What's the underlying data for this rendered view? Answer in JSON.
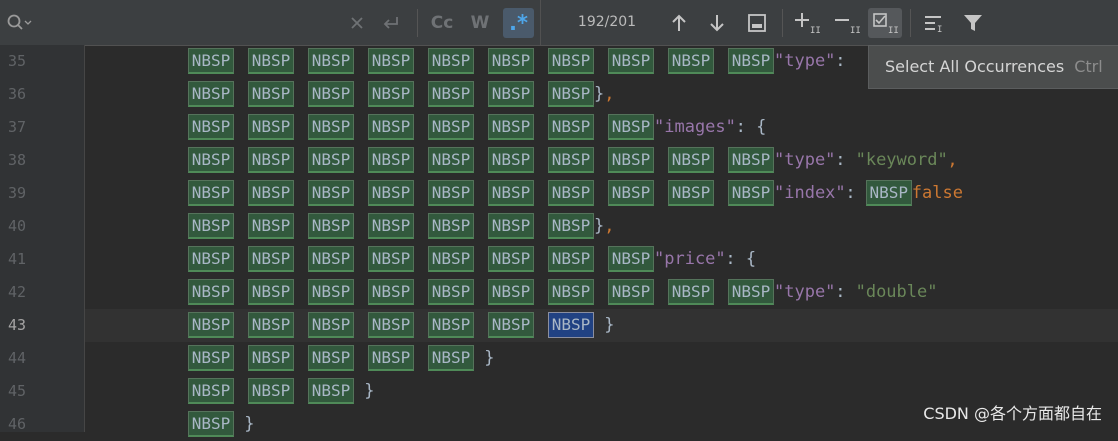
{
  "toolbar": {
    "match_count": "192/201",
    "case_option": "Cc",
    "words_option": "W",
    "regex_option": ".*",
    "icons": [
      "search-icon",
      "clear-icon",
      "replace-history-icon",
      "prev-occurrence-icon",
      "next-occurrence-icon",
      "in-selection-icon",
      "add-occurrence-icon",
      "remove-occurrence-icon",
      "select-all-occurrences-icon",
      "filter-results-icon",
      "filter-icon"
    ]
  },
  "tooltip": {
    "label": "Select All Occurrences",
    "shortcut": "Ctrl"
  },
  "editor": {
    "nbsp": "NBSP",
    "lines": [
      {
        "num": "35",
        "nbsp": 10,
        "tokens": [
          {
            "t": "\"type\"",
            "c": "key"
          },
          {
            "t": ": ",
            "c": "punc"
          }
        ]
      },
      {
        "num": "36",
        "nbsp": 7,
        "tokens": [
          {
            "t": "}",
            "c": "punc"
          },
          {
            "t": ",",
            "c": "comma"
          }
        ]
      },
      {
        "num": "37",
        "nbsp": 8,
        "tokens": [
          {
            "t": "\"images\"",
            "c": "key"
          },
          {
            "t": ": {",
            "c": "punc"
          }
        ]
      },
      {
        "num": "38",
        "nbsp": 10,
        "tokens": [
          {
            "t": "\"type\"",
            "c": "key"
          },
          {
            "t": ": ",
            "c": "punc"
          },
          {
            "t": "\"keyword\"",
            "c": "str"
          },
          {
            "t": ",",
            "c": "comma"
          }
        ]
      },
      {
        "num": "39",
        "nbsp": 10,
        "tokens": [
          {
            "t": "\"index\"",
            "c": "key"
          },
          {
            "t": ": ",
            "c": "punc"
          },
          {
            "t": "NBSP",
            "c": "nbsp"
          },
          {
            "t": "false",
            "c": "kw"
          }
        ]
      },
      {
        "num": "40",
        "nbsp": 7,
        "tokens": [
          {
            "t": "}",
            "c": "punc"
          },
          {
            "t": ",",
            "c": "comma"
          }
        ]
      },
      {
        "num": "41",
        "nbsp": 8,
        "tokens": [
          {
            "t": "\"price\"",
            "c": "key"
          },
          {
            "t": ": {",
            "c": "punc"
          }
        ]
      },
      {
        "num": "42",
        "nbsp": 10,
        "tokens": [
          {
            "t": "\"type\"",
            "c": "key"
          },
          {
            "t": ": ",
            "c": "punc"
          },
          {
            "t": "\"double\"",
            "c": "str"
          }
        ]
      },
      {
        "num": "43",
        "nbsp": 7,
        "current": true,
        "selected_index": 6,
        "tokens": [
          {
            "t": " }",
            "c": "punc"
          }
        ]
      },
      {
        "num": "44",
        "nbsp": 5,
        "tokens": [
          {
            "t": " }",
            "c": "punc"
          }
        ]
      },
      {
        "num": "45",
        "nbsp": 3,
        "tokens": [
          {
            "t": " }",
            "c": "punc"
          }
        ]
      },
      {
        "num": "46",
        "nbsp": 1,
        "tokens": [
          {
            "t": " }",
            "c": "punc"
          }
        ]
      }
    ]
  },
  "watermark": "CSDN @各个方面都自在"
}
